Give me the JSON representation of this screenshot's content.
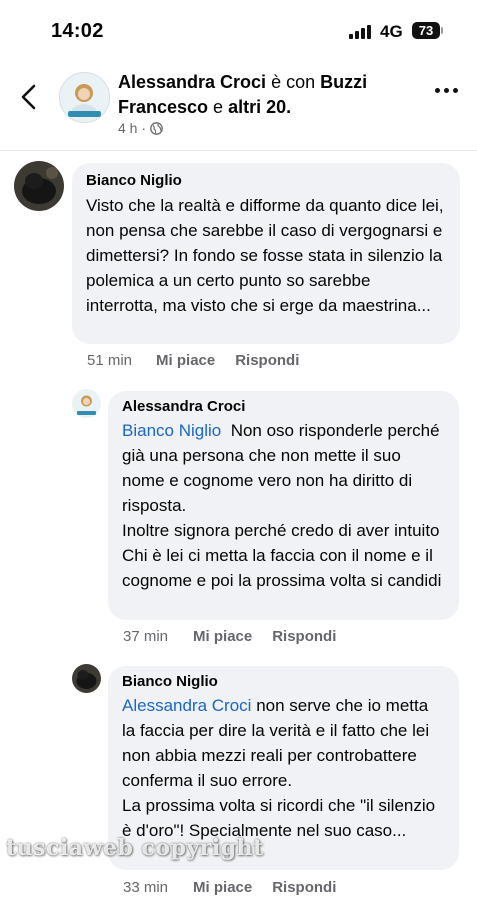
{
  "status_bar": {
    "time": "14:02",
    "network": "4G",
    "battery": "73"
  },
  "post_header": {
    "author": "Alessandra Croci",
    "connector": " è con ",
    "tagged": "Buzzi Francesco",
    "and": " e ",
    "others": "altri 20.",
    "age": "4 h ·"
  },
  "comments": [
    {
      "author": "Bianco Niglio",
      "mention": "",
      "text": "Visto che la realtà e difforme da quanto dice lei, non pensa che sarebbe il caso di vergognarsi e dimettersi? In fondo se fosse stata in silenzio la polemica a un certo punto so sarebbe interrotta, ma visto che si erge da maestrina...",
      "time": "51 min",
      "like": "Mi piace",
      "reply": "Rispondi"
    },
    {
      "author": "Alessandra Croci",
      "mention": "Bianco Niglio",
      "text": "Non oso risponderle perché già una persona che non mette il suo nome e cognome vero non ha diritto di risposta.\nInoltre signora perché credo di aver intuito Chi è lei ci metta la faccia con il nome e il cognome e poi la prossima volta si candidi",
      "time": "37 min",
      "like": "Mi piace",
      "reply": "Rispondi"
    },
    {
      "author": "Bianco Niglio",
      "mention": "Alessandra Croci",
      "text": "non serve che io metta la faccia per dire la verità e il fatto che lei non abbia mezzi reali per controbattere conferma il suo errore.\nLa prossima volta si ricordi che \"il silenzio è d'oro\"! Specialmente nel suo caso...",
      "time": "33 min",
      "like": "Mi piace",
      "reply": "Rispondi"
    }
  ],
  "watermark": "tusciaweb copyright",
  "icons": {
    "back": "chevron-left-icon",
    "more": "more-horizontal-icon",
    "audience": "globe-icon",
    "signal": "cellular-signal-icon",
    "battery": "battery-icon"
  },
  "colors": {
    "mention": "#1a67c9",
    "bubble": "#f0f2f5",
    "meta": "#65676b"
  }
}
